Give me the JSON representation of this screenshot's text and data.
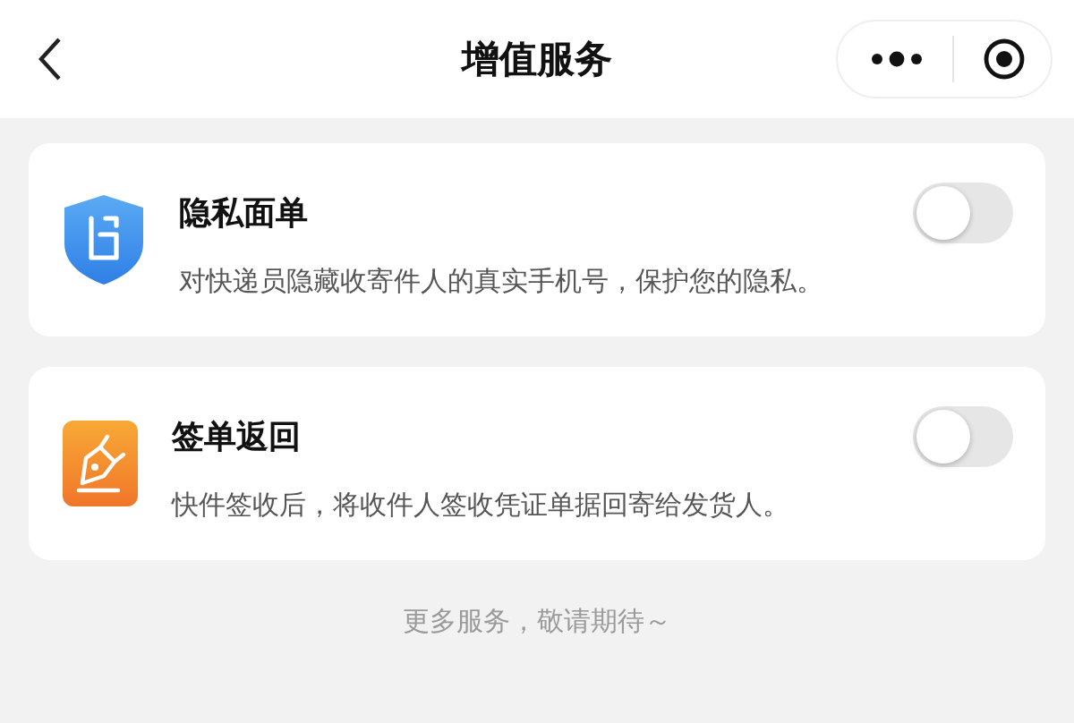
{
  "nav": {
    "title": "增值服务"
  },
  "services": [
    {
      "kind": "shield",
      "title": "隐私面单",
      "description": "对快递员隐藏收寄件人的真实手机号，保护您的隐私。",
      "on": false
    },
    {
      "kind": "pen",
      "title": "签单返回",
      "description": "快件签收后，将收件人签收凭证单据回寄给发货人。",
      "on": false
    }
  ],
  "footer": "更多服务，敬请期待～"
}
